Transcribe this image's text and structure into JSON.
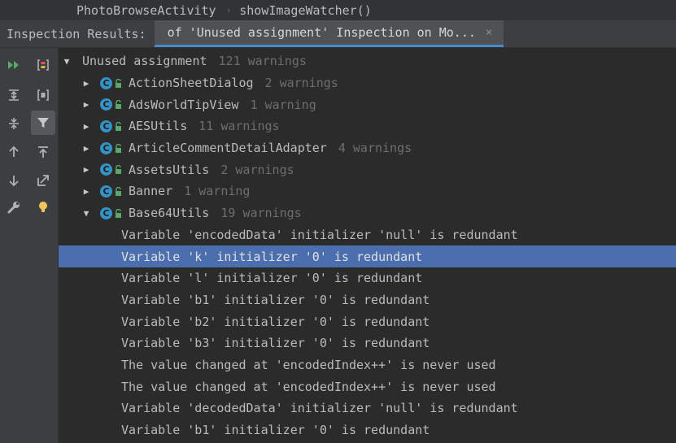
{
  "breadcrumb": {
    "items": [
      "PhotoBrowseActivity",
      "showImageWatcher()"
    ],
    "separator": "›"
  },
  "inspection": {
    "label": "Inspection Results:",
    "tab_title": "of 'Unused assignment' Inspection on Mo...",
    "close_icon": "×"
  },
  "toolbar": {
    "icons": [
      "run-icon",
      "group-brackets-icon",
      "expand-all-icon",
      "module-brackets-icon",
      "collapse-all-icon",
      "filter-icon",
      "previous-icon",
      "export-icon",
      "next-icon",
      "jump-to-source-icon",
      "wrench-icon",
      "lightbulb-icon"
    ]
  },
  "tree": {
    "root": {
      "label": "Unused assignment",
      "count": "121 warnings"
    },
    "classes": [
      {
        "name": "ActionSheetDialog",
        "count": "2 warnings",
        "expanded": false
      },
      {
        "name": "AdsWorldTipView",
        "count": "1 warning",
        "expanded": false
      },
      {
        "name": "AESUtils",
        "count": "11 warnings",
        "expanded": false
      },
      {
        "name": "ArticleCommentDetailAdapter",
        "count": "4 warnings",
        "expanded": false
      },
      {
        "name": "AssetsUtils",
        "count": "2 warnings",
        "expanded": false
      },
      {
        "name": "Banner",
        "count": "1 warning",
        "expanded": false
      },
      {
        "name": "Base64Utils",
        "count": "19 warnings",
        "expanded": true
      }
    ],
    "problems": [
      "Variable 'encodedData' initializer 'null' is redundant",
      "Variable 'k' initializer '0' is redundant",
      "Variable 'l' initializer '0' is redundant",
      "Variable 'b1' initializer '0' is redundant",
      "Variable 'b2' initializer '0' is redundant",
      "Variable 'b3' initializer '0' is redundant",
      "The value changed at 'encodedIndex++' is never used",
      "The value changed at 'encodedIndex++' is never used",
      "Variable 'decodedData' initializer 'null' is redundant",
      "Variable 'b1' initializer '0' is redundant"
    ],
    "selected_problem": 1
  },
  "colors": {
    "background": "#2b2b2b",
    "panel": "#3c3f41",
    "selection": "#4b6eaf",
    "class_icon": "#3592c4",
    "muted_text": "#6e6e6e",
    "run_green": "#59a869"
  }
}
